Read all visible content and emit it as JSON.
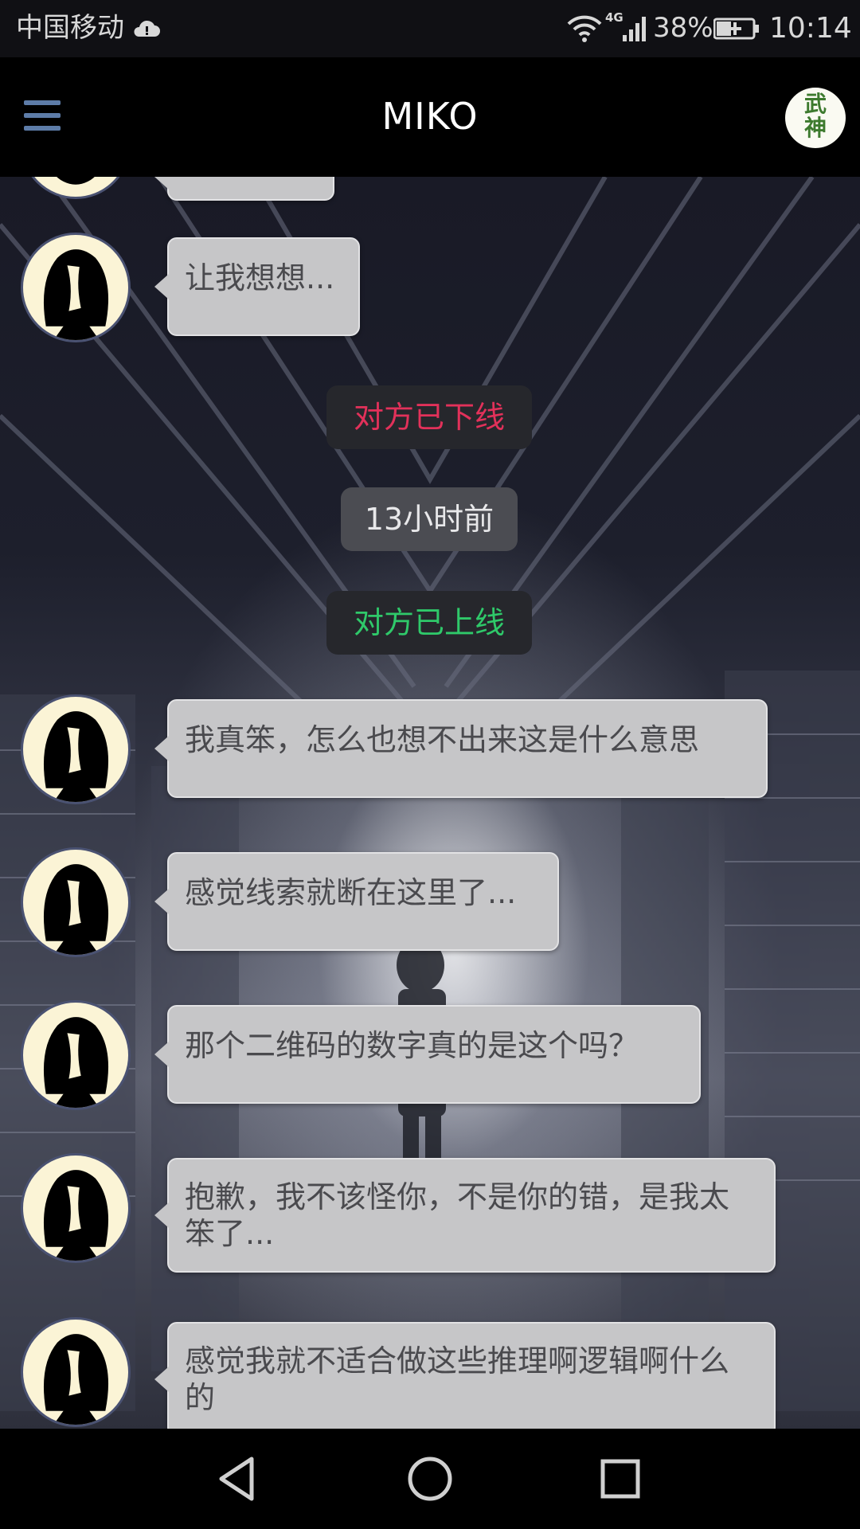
{
  "status_bar": {
    "carrier": "中国移动",
    "network_type": "4G",
    "battery_percent": "38%",
    "time": "10:14",
    "icons": [
      "cloud-icon",
      "wifi-icon",
      "signal-icon",
      "battery-charging-icon"
    ]
  },
  "app_bar": {
    "title": "MIKO",
    "menu_icon": "hamburger-menu-icon",
    "profile_avatar_text": "武神"
  },
  "chat": {
    "messages": [
      {
        "type": "received",
        "text": "让我想想..."
      },
      {
        "type": "system",
        "text": "对方已下线",
        "color": "#e2315a"
      },
      {
        "type": "timestamp",
        "text": "13小时前"
      },
      {
        "type": "system",
        "text": "对方已上线",
        "color": "#2fc96a"
      },
      {
        "type": "received",
        "text": "我真笨，怎么也想不出来这是什么意思"
      },
      {
        "type": "received",
        "text": "感觉线索就断在这里了..."
      },
      {
        "type": "received",
        "text": "那个二维码的数字真的是这个吗？"
      },
      {
        "type": "received",
        "text": "抱歉，我不该怪你，不是你的错，是我太笨了..."
      },
      {
        "type": "received",
        "text": "感觉我就不适合做这些推理啊逻辑啊什么的"
      }
    ]
  },
  "nav_bar": {
    "buttons": [
      "back-icon",
      "home-icon",
      "recents-icon"
    ]
  },
  "colors": {
    "bubble": "#c6c6c8",
    "bubble_text": "#4a4a4e",
    "menu_icon": "#5d7ca8",
    "offline": "#e2315a",
    "online": "#2fc96a"
  }
}
